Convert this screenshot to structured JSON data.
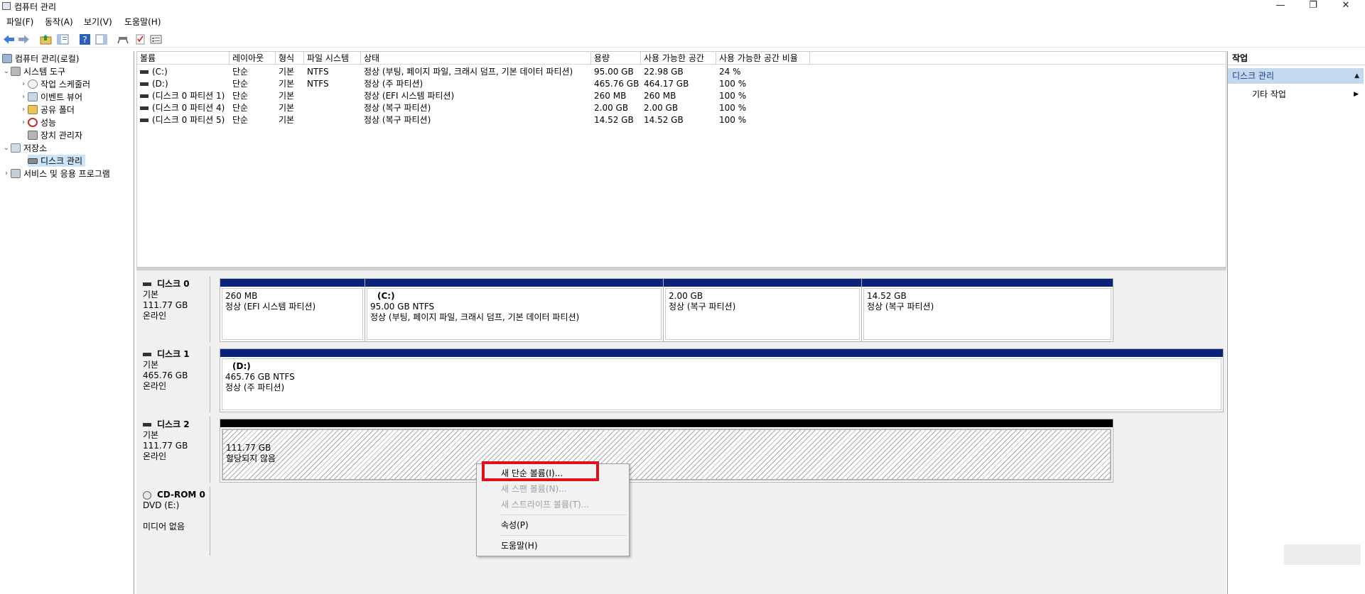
{
  "window": {
    "title": "컴퓨터 관리",
    "minimize": "—",
    "restore": "❐",
    "close": "✕"
  },
  "menu": [
    "파일(F)",
    "동작(A)",
    "보기(V)",
    "도움말(H)"
  ],
  "tree": {
    "root": "컴퓨터 관리(로컬)",
    "system_tools": "시스템 도구",
    "task_scheduler": "작업 스케줄러",
    "event_viewer": "이벤트 뷰어",
    "shared_folders": "공유 폴더",
    "performance": "성능",
    "device_manager": "장치 관리자",
    "storage": "저장소",
    "disk_management": "디스크 관리",
    "services": "서비스 및 응용 프로그램"
  },
  "columns": [
    "볼륨",
    "레이아웃",
    "형식",
    "파일 시스템",
    "상태",
    "용량",
    "사용 가능한 공간",
    "사용 가능한 공간 비율"
  ],
  "volumes": [
    {
      "name": "(C:)",
      "layout": "단순",
      "type": "기본",
      "fs": "NTFS",
      "status": "정상 (부팅, 페이지 파일, 크래시 덤프, 기본 데이터 파티션)",
      "capacity": "95.00 GB",
      "free": "22.98 GB",
      "pct": "24 %"
    },
    {
      "name": "(D:)",
      "layout": "단순",
      "type": "기본",
      "fs": "NTFS",
      "status": "정상 (주 파티션)",
      "capacity": "465.76 GB",
      "free": "464.17 GB",
      "pct": "100 %"
    },
    {
      "name": "(디스크 0 파티션 1)",
      "layout": "단순",
      "type": "기본",
      "fs": "",
      "status": "정상 (EFI 시스템 파티션)",
      "capacity": "260 MB",
      "free": "260 MB",
      "pct": "100 %"
    },
    {
      "name": "(디스크 0 파티션 4)",
      "layout": "단순",
      "type": "기본",
      "fs": "",
      "status": "정상 (복구 파티션)",
      "capacity": "2.00 GB",
      "free": "2.00 GB",
      "pct": "100 %"
    },
    {
      "name": "(디스크 0 파티션 5)",
      "layout": "단순",
      "type": "기본",
      "fs": "",
      "status": "정상 (복구 파티션)",
      "capacity": "14.52 GB",
      "free": "14.52 GB",
      "pct": "100 %"
    }
  ],
  "disks": {
    "d0": {
      "name": "디스크 0",
      "type": "기본",
      "size": "111.77 GB",
      "state": "온라인",
      "parts": [
        {
          "label": "",
          "size": "260 MB",
          "status": "정상 (EFI 시스템 파티션)"
        },
        {
          "label": "(C:)",
          "size": "95.00 GB NTFS",
          "status": "정상 (부팅, 페이지 파일, 크래시 덤프, 기본 데이터 파티션)"
        },
        {
          "label": "",
          "size": "2.00 GB",
          "status": "정상 (복구 파티션)"
        },
        {
          "label": "",
          "size": "14.52 GB",
          "status": "정상 (복구 파티션)"
        }
      ]
    },
    "d1": {
      "name": "디스크 1",
      "type": "기본",
      "size": "465.76 GB",
      "state": "온라인",
      "parts": [
        {
          "label": "(D:)",
          "size": "465.76 GB NTFS",
          "status": "정상 (주 파티션)"
        }
      ]
    },
    "d2": {
      "name": "디스크 2",
      "type": "기본",
      "size": "111.77 GB",
      "state": "온라인",
      "parts": [
        {
          "label": "",
          "size": "111.77 GB",
          "status": "할당되지 않음"
        }
      ]
    },
    "cd": {
      "name": "CD-ROM 0",
      "type": "DVD (E:)",
      "state": "미디어 없음"
    }
  },
  "actions": {
    "header": "작업",
    "section": "디스크 관리",
    "more": "기타 작업"
  },
  "context_menu": [
    {
      "label": "새 단순 볼륨(I)...",
      "enabled": true
    },
    {
      "label": "새 스팬 볼륨(N)...",
      "enabled": false
    },
    {
      "label": "새 스트라이프 볼륨(T)...",
      "enabled": false
    },
    {
      "label": "속성(P)",
      "enabled": true
    },
    {
      "label": "도움말(H)",
      "enabled": true
    }
  ],
  "colors": {
    "partition_bar": "#0a2479",
    "unallocated_bar": "#000000",
    "highlight": "#e0101a",
    "selection": "#cce4f7"
  }
}
